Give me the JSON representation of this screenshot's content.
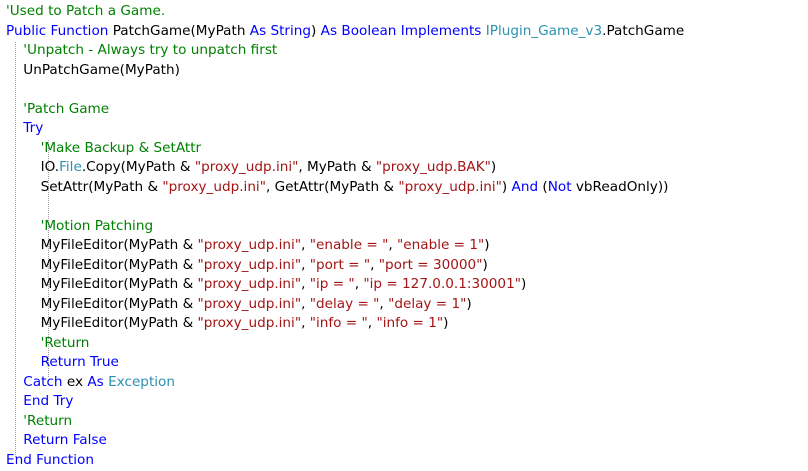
{
  "colors": {
    "keyword": "#0000ff",
    "comment": "#008000",
    "string": "#a31515",
    "type": "#2b91af",
    "text": "#000000",
    "background": "#ffffff"
  },
  "code": {
    "lines": [
      [
        {
          "t": "cm",
          "v": "'Used to Patch a Game."
        }
      ],
      [
        {
          "t": "kw",
          "v": "Public Function"
        },
        {
          "t": "tx",
          "v": " PatchGame(MyPath "
        },
        {
          "t": "kw",
          "v": "As String"
        },
        {
          "t": "tx",
          "v": ") "
        },
        {
          "t": "kw",
          "v": "As Boolean Implements"
        },
        {
          "t": "tx",
          "v": " "
        },
        {
          "t": "ty",
          "v": "IPlugin_Game_v3"
        },
        {
          "t": "tx",
          "v": ".PatchGame"
        }
      ],
      [
        {
          "t": "tx",
          "v": "    "
        },
        {
          "t": "cm",
          "v": "'Unpatch - Always try to unpatch first"
        }
      ],
      [
        {
          "t": "tx",
          "v": "    UnPatchGame(MyPath)"
        }
      ],
      [],
      [
        {
          "t": "tx",
          "v": "    "
        },
        {
          "t": "cm",
          "v": "'Patch Game"
        }
      ],
      [
        {
          "t": "tx",
          "v": "    "
        },
        {
          "t": "kw",
          "v": "Try"
        }
      ],
      [
        {
          "t": "tx",
          "v": "        "
        },
        {
          "t": "cm",
          "v": "'Make Backup & SetAttr"
        }
      ],
      [
        {
          "t": "tx",
          "v": "        IO."
        },
        {
          "t": "ty",
          "v": "File"
        },
        {
          "t": "tx",
          "v": ".Copy(MyPath & "
        },
        {
          "t": "str",
          "v": "\"proxy_udp.ini\""
        },
        {
          "t": "tx",
          "v": ", MyPath & "
        },
        {
          "t": "str",
          "v": "\"proxy_udp.BAK\""
        },
        {
          "t": "tx",
          "v": ")"
        }
      ],
      [
        {
          "t": "tx",
          "v": "        SetAttr(MyPath & "
        },
        {
          "t": "str",
          "v": "\"proxy_udp.ini\""
        },
        {
          "t": "tx",
          "v": ", GetAttr(MyPath & "
        },
        {
          "t": "str",
          "v": "\"proxy_udp.ini\""
        },
        {
          "t": "tx",
          "v": ") "
        },
        {
          "t": "kw",
          "v": "And"
        },
        {
          "t": "tx",
          "v": " ("
        },
        {
          "t": "kw",
          "v": "Not"
        },
        {
          "t": "tx",
          "v": " vbReadOnly))"
        }
      ],
      [],
      [
        {
          "t": "tx",
          "v": "        "
        },
        {
          "t": "cm",
          "v": "'Motion Patching"
        }
      ],
      [
        {
          "t": "tx",
          "v": "        MyFileEditor(MyPath & "
        },
        {
          "t": "str",
          "v": "\"proxy_udp.ini\""
        },
        {
          "t": "tx",
          "v": ", "
        },
        {
          "t": "str",
          "v": "\"enable = \""
        },
        {
          "t": "tx",
          "v": ", "
        },
        {
          "t": "str",
          "v": "\"enable = 1\""
        },
        {
          "t": "tx",
          "v": ")"
        }
      ],
      [
        {
          "t": "tx",
          "v": "        MyFileEditor(MyPath & "
        },
        {
          "t": "str",
          "v": "\"proxy_udp.ini\""
        },
        {
          "t": "tx",
          "v": ", "
        },
        {
          "t": "str",
          "v": "\"port = \""
        },
        {
          "t": "tx",
          "v": ", "
        },
        {
          "t": "str",
          "v": "\"port = 30000\""
        },
        {
          "t": "tx",
          "v": ")"
        }
      ],
      [
        {
          "t": "tx",
          "v": "        MyFileEditor(MyPath & "
        },
        {
          "t": "str",
          "v": "\"proxy_udp.ini\""
        },
        {
          "t": "tx",
          "v": ", "
        },
        {
          "t": "str",
          "v": "\"ip = \""
        },
        {
          "t": "tx",
          "v": ", "
        },
        {
          "t": "str",
          "v": "\"ip = 127.0.0.1:30001\""
        },
        {
          "t": "tx",
          "v": ")"
        }
      ],
      [
        {
          "t": "tx",
          "v": "        MyFileEditor(MyPath & "
        },
        {
          "t": "str",
          "v": "\"proxy_udp.ini\""
        },
        {
          "t": "tx",
          "v": ", "
        },
        {
          "t": "str",
          "v": "\"delay = \""
        },
        {
          "t": "tx",
          "v": ", "
        },
        {
          "t": "str",
          "v": "\"delay = 1\""
        },
        {
          "t": "tx",
          "v": ")"
        }
      ],
      [
        {
          "t": "tx",
          "v": "        MyFileEditor(MyPath & "
        },
        {
          "t": "str",
          "v": "\"proxy_udp.ini\""
        },
        {
          "t": "tx",
          "v": ", "
        },
        {
          "t": "str",
          "v": "\"info = \""
        },
        {
          "t": "tx",
          "v": ", "
        },
        {
          "t": "str",
          "v": "\"info = 1\""
        },
        {
          "t": "tx",
          "v": ")"
        }
      ],
      [
        {
          "t": "tx",
          "v": "        "
        },
        {
          "t": "cm",
          "v": "'Return"
        }
      ],
      [
        {
          "t": "tx",
          "v": "        "
        },
        {
          "t": "kw",
          "v": "Return True"
        }
      ],
      [
        {
          "t": "tx",
          "v": "    "
        },
        {
          "t": "kw",
          "v": "Catch"
        },
        {
          "t": "tx",
          "v": " ex "
        },
        {
          "t": "kw",
          "v": "As"
        },
        {
          "t": "tx",
          "v": " "
        },
        {
          "t": "ty",
          "v": "Exception"
        }
      ],
      [
        {
          "t": "tx",
          "v": "    "
        },
        {
          "t": "kw",
          "v": "End Try"
        }
      ],
      [
        {
          "t": "tx",
          "v": "    "
        },
        {
          "t": "cm",
          "v": "'Return"
        }
      ],
      [
        {
          "t": "tx",
          "v": "    "
        },
        {
          "t": "kw",
          "v": "Return False"
        }
      ],
      [
        {
          "t": "kw",
          "v": "End Function"
        }
      ]
    ]
  }
}
